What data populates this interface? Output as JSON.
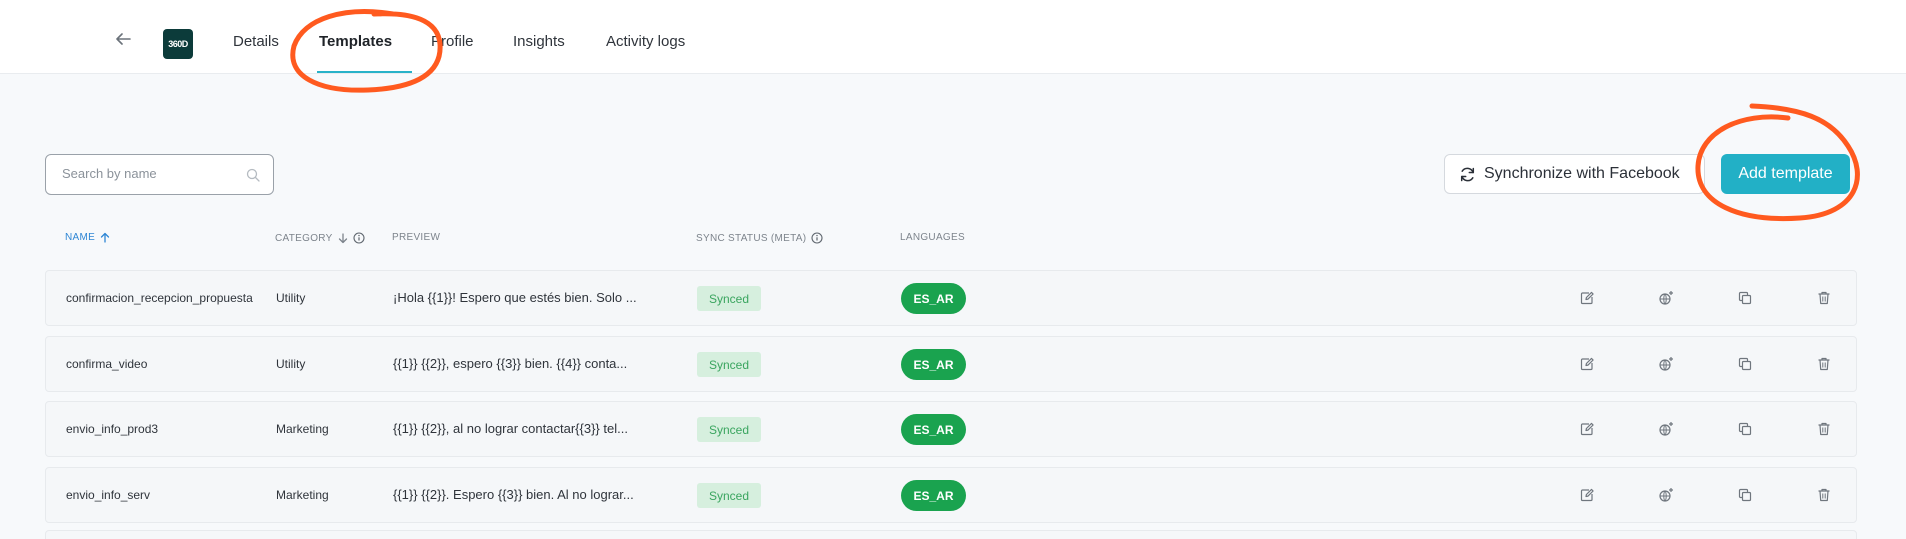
{
  "header": {
    "logo_text": "360D",
    "tabs": [
      {
        "label": "Details"
      },
      {
        "label": "Templates"
      },
      {
        "label": "Profile"
      },
      {
        "label": "Insights"
      },
      {
        "label": "Activity logs"
      }
    ]
  },
  "toolbar": {
    "search_placeholder": "Search by name",
    "sync_label": "Synchronize with Facebook",
    "add_label": "Add template"
  },
  "table": {
    "columns": [
      "Name",
      "Category",
      "Preview",
      "Sync status (META)",
      "Languages"
    ],
    "rows": [
      {
        "name": "confirmacion_recepcion_propuesta",
        "category": "Utility",
        "preview": "¡Hola {{1}}! Espero que estés bien. Solo ...",
        "status": "Synced",
        "language": "ES_AR"
      },
      {
        "name": "confirma_video",
        "category": "Utility",
        "preview": "{{1}} {{2}}, espero {{3}} bien. {{4}} conta...",
        "status": "Synced",
        "language": "ES_AR"
      },
      {
        "name": "envio_info_prod3",
        "category": "Marketing",
        "preview": "{{1}} {{2}}, al no lograr contactar{{3}} tel...",
        "status": "Synced",
        "language": "ES_AR"
      },
      {
        "name": "envio_info_serv",
        "category": "Marketing",
        "preview": "{{1}} {{2}}. Espero {{3}} bien. Al no lograr...",
        "status": "Synced",
        "language": "ES_AR"
      }
    ]
  },
  "colors": {
    "accent": "#22b0c6",
    "annotation": "#ff5a1f",
    "synced_bg": "#d6efde",
    "language_badge": "#1aa34f"
  },
  "icons": [
    "back-arrow-icon",
    "search-icon",
    "sync-icon",
    "sort-up-icon",
    "sort-down-icon",
    "info-icon",
    "edit-icon",
    "translate-icon",
    "copy-icon",
    "trash-icon"
  ]
}
